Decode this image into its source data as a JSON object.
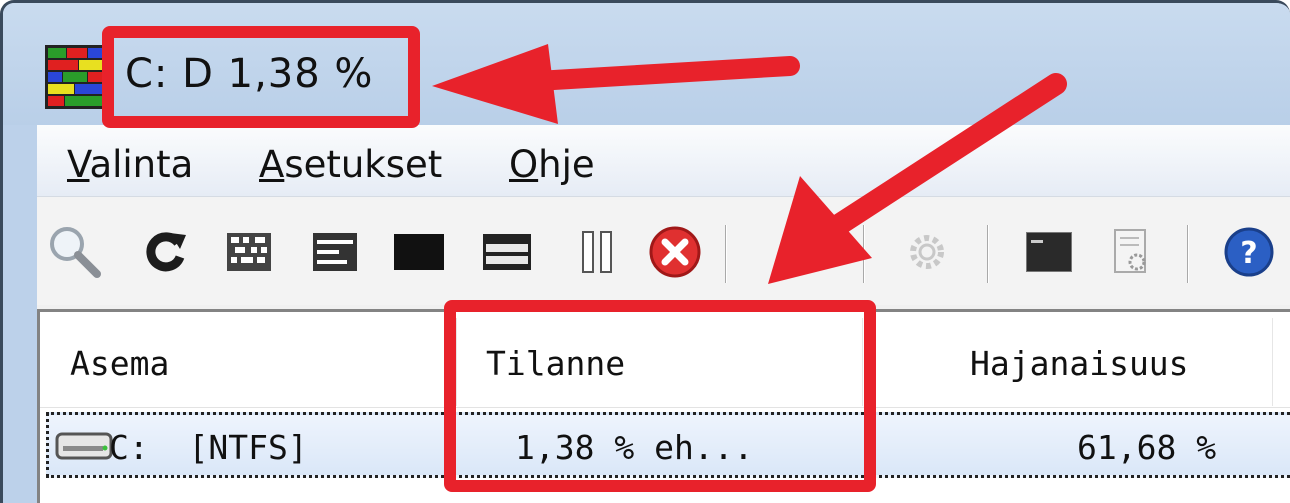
{
  "window": {
    "title": "C: D  1,38 %",
    "icon": "defrag-app-icon"
  },
  "menu": {
    "items": [
      {
        "accel": "V",
        "rest": "alinta"
      },
      {
        "accel": "A",
        "rest": "setukset"
      },
      {
        "accel": "O",
        "rest": "hje"
      }
    ]
  },
  "toolbar": {
    "icons": [
      "analyze-magnifier-icon",
      "refresh-icon",
      "defrag-pattern-icon",
      "compact-icon",
      "black-block-icon",
      "list-block-icon",
      "pause-icon",
      "stop-icon",
      "disabled-icon",
      "settings-gear-icon",
      "console-icon",
      "script-icon",
      "help-icon"
    ]
  },
  "listview": {
    "columns": [
      "Asema",
      "Tilanne",
      "Hajanaisuus"
    ],
    "rows": [
      {
        "drive": "C:  [NTFS]",
        "status": "1,38 % eh...",
        "fragmentation": "61,68 %"
      }
    ]
  },
  "annotation": {
    "color": "#e8222b"
  }
}
